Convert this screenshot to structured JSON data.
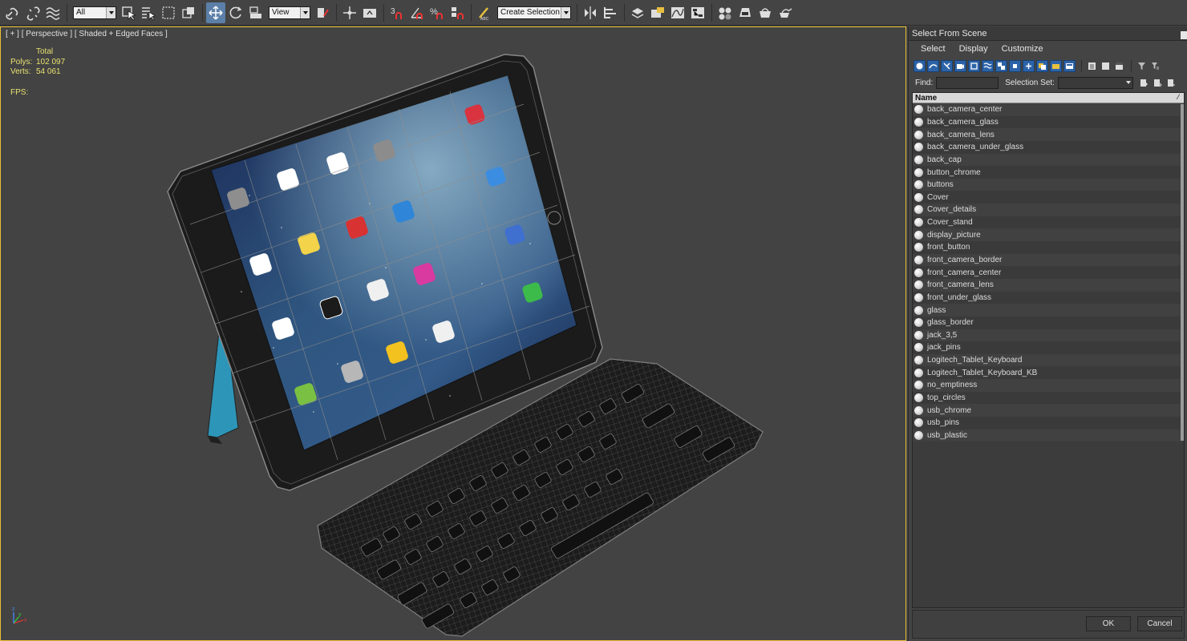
{
  "toolbar": {
    "filter_value": "All",
    "ref_coord_value": "View",
    "selection_set_placeholder": "Create Selection Se",
    "snap_label": "3",
    "icons": [
      "link-icon",
      "unlink-icon",
      "bind-spacewarp-icon",
      "select-object-icon",
      "select-by-name-icon",
      "rect-region-icon",
      "window-crossing-icon",
      "move-icon",
      "rotate-icon",
      "scale-icon",
      "pivot-icon",
      "select-manipulate-icon",
      "keyboard-shortcut-icon",
      "snap-icon",
      "angle-snap-icon",
      "percent-snap-icon",
      "spinner-snap-icon",
      "edit-named-sets-icon",
      "mirror-icon",
      "align-icon",
      "layer-icon",
      "scene-explorer-icon",
      "curve-editor-icon",
      "schematic-icon",
      "material-editor-icon",
      "render-setup-icon",
      "rendered-frame-icon",
      "render-icon"
    ]
  },
  "viewport": {
    "label": "[ + ] [ Perspective ] [ Shaded + Edged Faces ]",
    "stats": {
      "header": "Total",
      "polys_label": "Polys:",
      "polys_value": "102 097",
      "verts_label": "Verts:",
      "verts_value": "54 061",
      "fps_label": "FPS:"
    },
    "axis": {
      "x": "x",
      "y": "y",
      "z": "z"
    }
  },
  "panel": {
    "title": "Select From Scene",
    "menu": [
      "Select",
      "Display",
      "Customize"
    ],
    "find_label": "Find:",
    "selection_set_label": "Selection Set:",
    "column_name": "Name",
    "objects": [
      "back_camera_center",
      "back_camera_glass",
      "back_camera_lens",
      "back_camera_under_glass",
      "back_cap",
      "button_chrome",
      "buttons",
      "Cover",
      "Cover_details",
      "Cover_stand",
      "display_picture",
      "front_button",
      "front_camera_border",
      "front_camera_center",
      "front_camera_lens",
      "front_under_glass",
      "glass",
      "glass_border",
      "jack_3,5",
      "jack_pins",
      "Logitech_Tablet_Keyboard",
      "Logitech_Tablet_Keyboard_KB",
      "no_emptiness",
      "top_circles",
      "usb_chrome",
      "usb_pins",
      "usb_plastic"
    ],
    "ok_label": "OK",
    "cancel_label": "Cancel"
  }
}
